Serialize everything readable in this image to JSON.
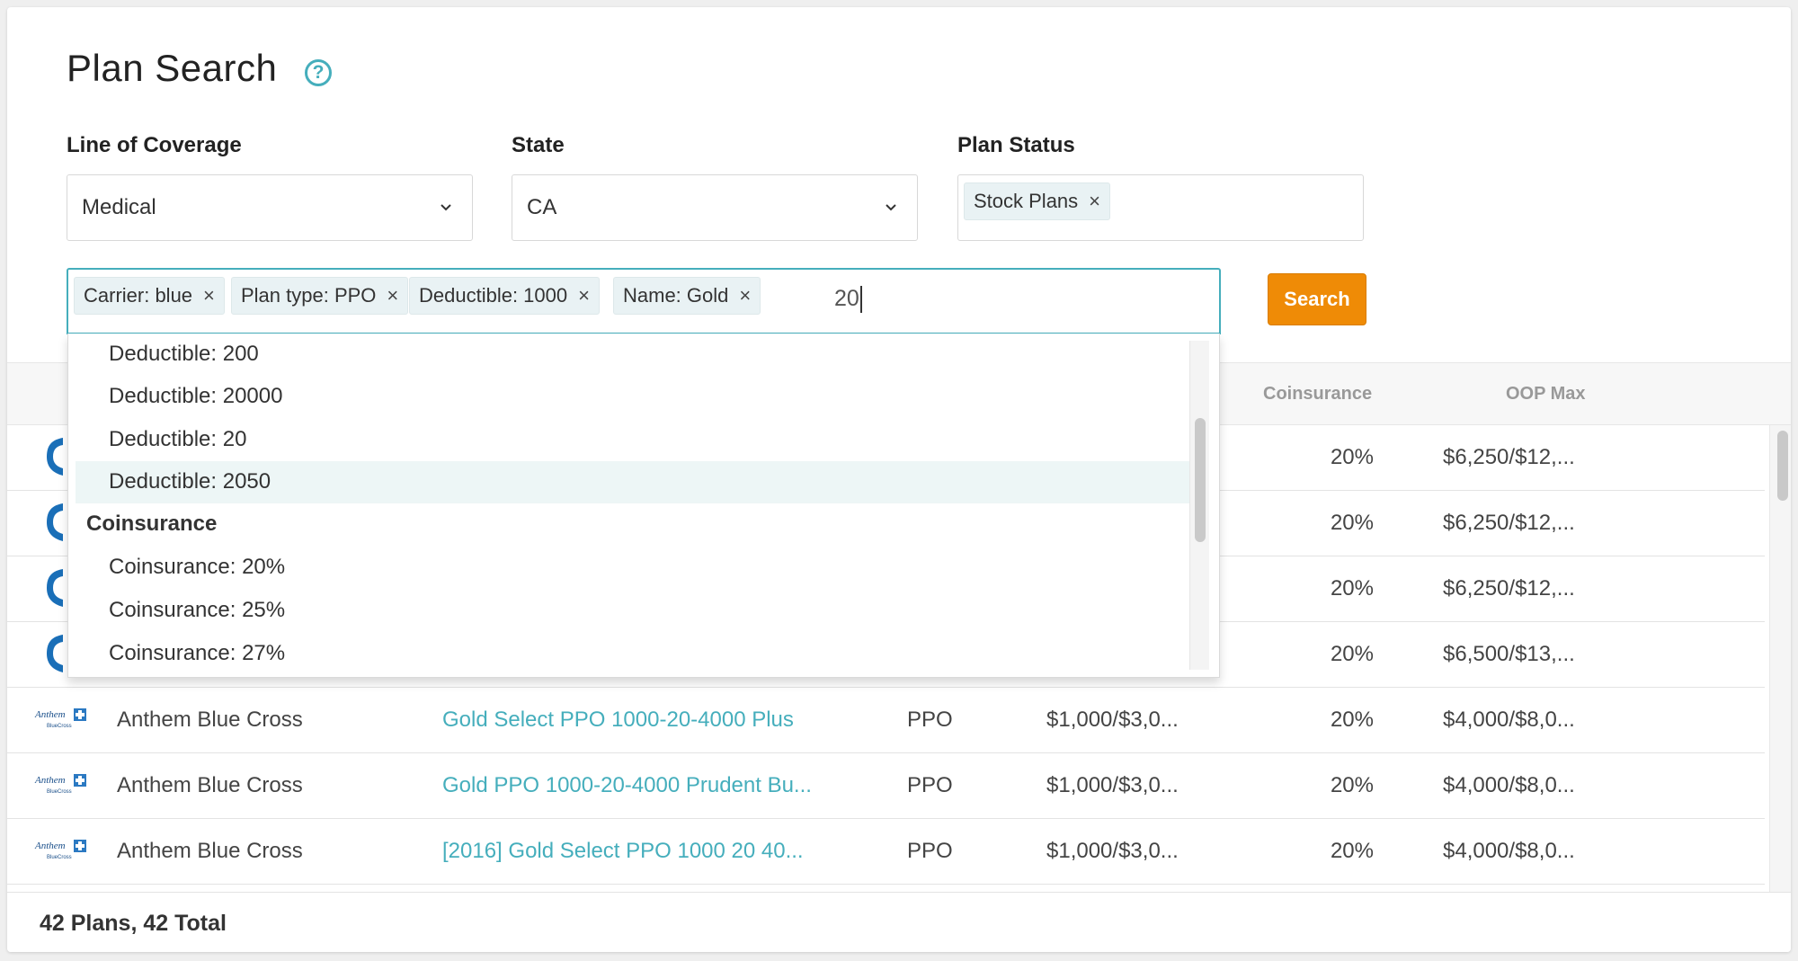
{
  "page": {
    "title": "Plan Search"
  },
  "filters": {
    "coverage": {
      "label": "Line of Coverage",
      "value": "Medical"
    },
    "state": {
      "label": "State",
      "value": "CA"
    },
    "status": {
      "label": "Plan Status",
      "chip": "Stock Plans"
    }
  },
  "search": {
    "chips": [
      "Carrier: blue",
      "Plan type: PPO",
      "Deductible: 1000",
      "Name: Gold"
    ],
    "typed": "20",
    "button": "Search"
  },
  "dropdown": {
    "deductible_options": [
      "Deductible: 200",
      "Deductible: 20000",
      "Deductible: 20",
      "Deductible: 2050"
    ],
    "highlighted": "Deductible: 2050",
    "group_label": "Coinsurance",
    "coinsurance_options": [
      "Coinsurance: 20%",
      "Coinsurance: 25%",
      "Coinsurance: 27%"
    ]
  },
  "table": {
    "columns": {
      "coinsurance": "Coinsurance",
      "oop": "OOP Max"
    },
    "rows": [
      {
        "logo": "bcbs-shield-icon",
        "carrier": "",
        "name": "",
        "type": "",
        "deductible": "",
        "coinsurance": "20%",
        "oop": "$6,250/$12,..."
      },
      {
        "logo": "bcbs-shield-icon",
        "carrier": "",
        "name": "",
        "type": "",
        "deductible": "",
        "coinsurance": "20%",
        "oop": "$6,250/$12,..."
      },
      {
        "logo": "bcbs-shield-icon",
        "carrier": "",
        "name": "",
        "type": "",
        "deductible": "",
        "coinsurance": "20%",
        "oop": "$6,250/$12,..."
      },
      {
        "logo": "bcbs-shield-icon",
        "carrier": "",
        "name": "",
        "type": "",
        "deductible": "",
        "coinsurance": "20%",
        "oop": "$6,500/$13,..."
      },
      {
        "logo": "anthem-logo",
        "carrier": "Anthem Blue Cross",
        "name": "Gold Select PPO 1000-20-4000 Plus",
        "type": "PPO",
        "deductible": "$1,000/$3,0...",
        "coinsurance": "20%",
        "oop": "$4,000/$8,0..."
      },
      {
        "logo": "anthem-logo",
        "carrier": "Anthem Blue Cross",
        "name": "Gold PPO 1000-20-4000 Prudent Bu...",
        "type": "PPO",
        "deductible": "$1,000/$3,0...",
        "coinsurance": "20%",
        "oop": "$4,000/$8,0..."
      },
      {
        "logo": "anthem-logo",
        "carrier": "Anthem Blue Cross",
        "name": "[2016] Gold Select PPO 1000 20 40...",
        "type": "PPO",
        "deductible": "$1,000/$3,0...",
        "coinsurance": "20%",
        "oop": "$4,000/$8,0..."
      }
    ]
  },
  "footer": {
    "count": "42 Plans, 42 Total"
  },
  "colors": {
    "accent": "#45aebc",
    "button": "#ef8b06",
    "highlight": "#edf6f6",
    "bcbs": "#1a6fb8"
  }
}
